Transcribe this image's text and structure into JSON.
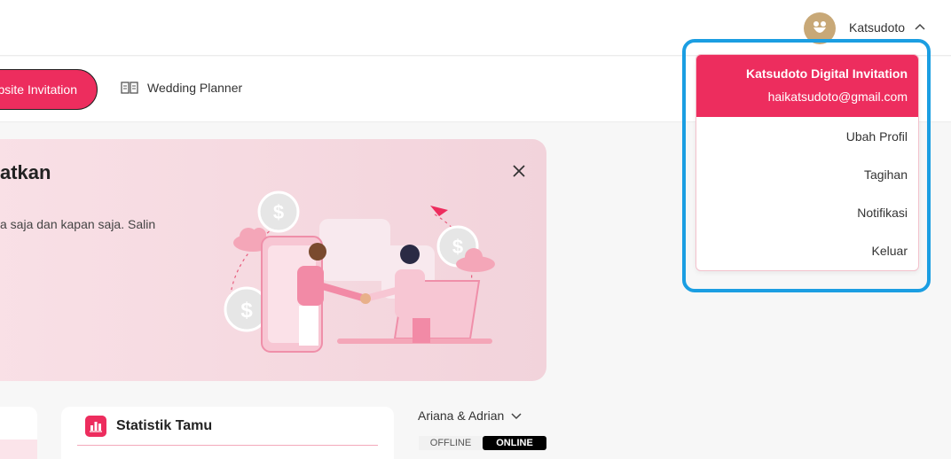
{
  "topbar": {
    "user_name": "Katsudoto"
  },
  "nav": {
    "active_label": "Website Invitation",
    "planner_label": "Wedding Planner"
  },
  "banner": {
    "title": "atkan",
    "text": "a saja dan kapan saja. Salin"
  },
  "stats": {
    "title": "Statistik Tamu"
  },
  "couple": {
    "name": "Ariana & Adrian",
    "offline_label": "OFFLINE",
    "online_label": "ONLINE"
  },
  "dropdown": {
    "name": "Katsudoto Digital Invitation",
    "email": "haikatsudoto@gmail.com",
    "items": [
      "Ubah Profil",
      "Tagihan",
      "Notifikasi",
      "Keluar"
    ]
  },
  "colors": {
    "accent": "#ed2d5e",
    "highlight": "#1b9ee2",
    "avatar": "#c8a877"
  }
}
